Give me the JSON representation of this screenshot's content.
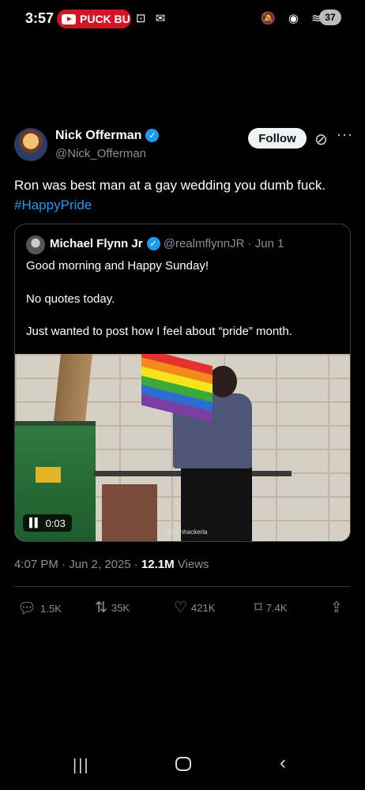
{
  "status_bar": {
    "time": "3:57",
    "puck_label": "PUCK BU",
    "left_icons": "⊡ ✉",
    "right_icons": "🔕 ◉ ≋",
    "battery": "37"
  },
  "tweet": {
    "author_name": "Nick Offerman",
    "author_handle": "@Nick_Offerman",
    "follow_label": "Follow",
    "text": "Ron was best man at a gay wedding you dumb fuck.",
    "hashtag": "#HappyPride",
    "timestamp": "4:07 PM · Jun 2, 2025 · ",
    "views_count": "12.1M",
    "views_label": " Views"
  },
  "quote": {
    "author_name": "Michael Flynn Jr",
    "author_handle": "@realmflynnJR · Jun 1",
    "line1": "Good morning and Happy Sunday!",
    "line2": "No quotes today.",
    "line3": "Just wanted to post how I feel about “pride” month.",
    "media_time": "0:03",
    "watermark": "@johnhackerla"
  },
  "actions": {
    "replies": "1.5K",
    "reposts": "35K",
    "likes": "421K",
    "bookmarks": "7.4K"
  },
  "colors": {
    "accent": "#1d9bf0",
    "background": "#000000",
    "secondary_text": "#8b8f94"
  }
}
